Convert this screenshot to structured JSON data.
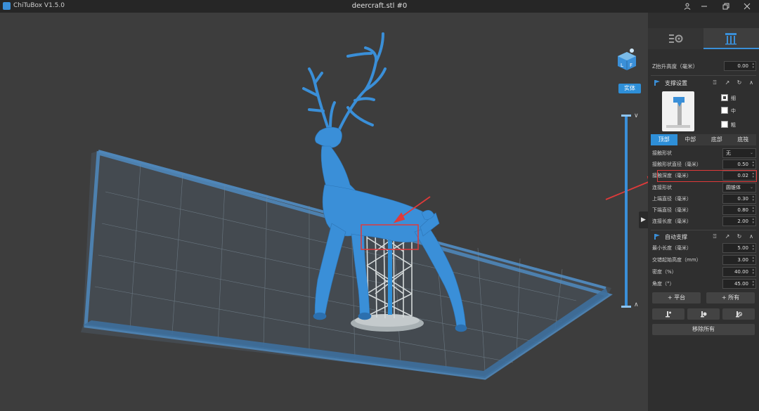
{
  "window": {
    "app_name": "ChiTuBox V1.5.0",
    "document_title": "deercraft.stl #0"
  },
  "viewport": {
    "mode_badge": "实体"
  },
  "panel": {
    "z_lift": {
      "label": "Z抬升高度（毫米）",
      "value": "0.00"
    },
    "support_settings": {
      "title": "支撑设置",
      "density_options": [
        {
          "label": "细",
          "checked": true
        },
        {
          "label": "中",
          "checked": false
        },
        {
          "label": "粗",
          "checked": false
        }
      ],
      "parts": [
        {
          "label": "顶部",
          "active": true
        },
        {
          "label": "中部",
          "active": false
        },
        {
          "label": "底部",
          "active": false
        },
        {
          "label": "底筏",
          "active": false
        }
      ],
      "fields": [
        {
          "label": "接触形状",
          "value": "无",
          "type": "select"
        },
        {
          "label": "接触形状直径（毫米）",
          "value": "0.50",
          "type": "number"
        },
        {
          "label": "接触深度（毫米）",
          "value": "0.02",
          "type": "number"
        },
        {
          "label": "连接形状",
          "value": "圆锥体",
          "type": "select"
        },
        {
          "label": "上端直径（毫米）",
          "value": "0.30",
          "type": "number"
        },
        {
          "label": "下端直径（毫米）",
          "value": "0.80",
          "type": "number"
        },
        {
          "label": "连接长度（毫米）",
          "value": "2.00",
          "type": "number"
        }
      ]
    },
    "auto_support": {
      "title": "自动支撑",
      "fields": [
        {
          "label": "最小长度（毫米）",
          "value": "5.00"
        },
        {
          "label": "交错起始高度（mm）",
          "value": "3.00"
        },
        {
          "label": "密度（%）",
          "value": "40.00"
        },
        {
          "label": "角度（°）",
          "value": "45.00"
        }
      ],
      "platform_button": "+ 平台",
      "all_button": "+ 所有",
      "remove_all_button": "移除所有"
    }
  },
  "colors": {
    "accent": "#2e8fd8",
    "model": "#3a8fd8",
    "highlight": "#e03a3a"
  }
}
